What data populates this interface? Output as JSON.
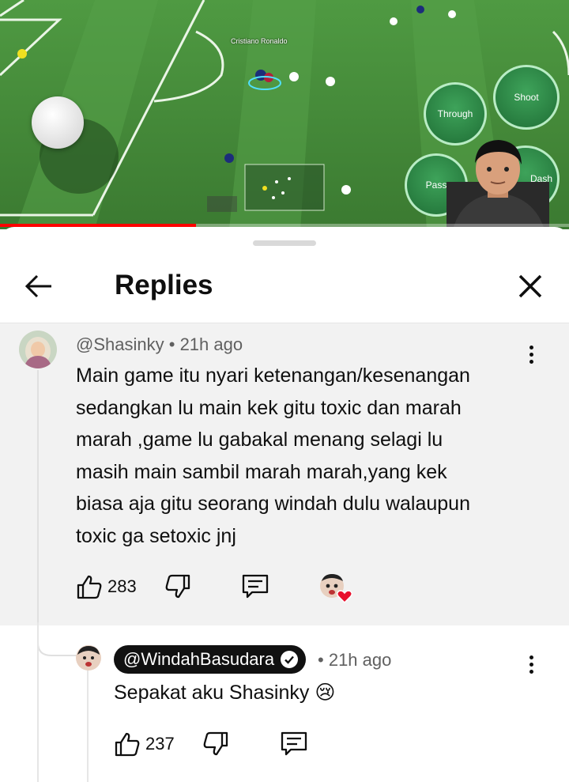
{
  "video": {
    "player_label": "Cristiano Ronaldo",
    "controls": {
      "through": "Through",
      "shoot": "Shoot",
      "pass": "Pass",
      "dash": "Dash"
    },
    "progress_fraction": 0.345
  },
  "header": {
    "title": "Replies"
  },
  "parent_comment": {
    "author": "@Shasinky",
    "separator": "•",
    "time": "21h ago",
    "lines": [
      "Main game itu nyari ketenangan/kesenangan",
      "sedangkan lu main kek gitu toxic dan marah",
      "marah ,game lu gabakal menang selagi lu",
      "masih main sambil marah marah,yang kek",
      "biasa aja gitu seorang windah dulu walaupun",
      "toxic ga setoxic jnj"
    ],
    "likes": "283"
  },
  "reply": {
    "author": "@WindahBasudara",
    "separator": "•",
    "time": "21h ago",
    "text": "Sepakat aku Shasinky 😢",
    "likes": "237"
  },
  "colors": {
    "progress": "#ff0000",
    "heart": "#e8112d",
    "chip": "#111111",
    "thread_bg": "#f2f2f2"
  }
}
